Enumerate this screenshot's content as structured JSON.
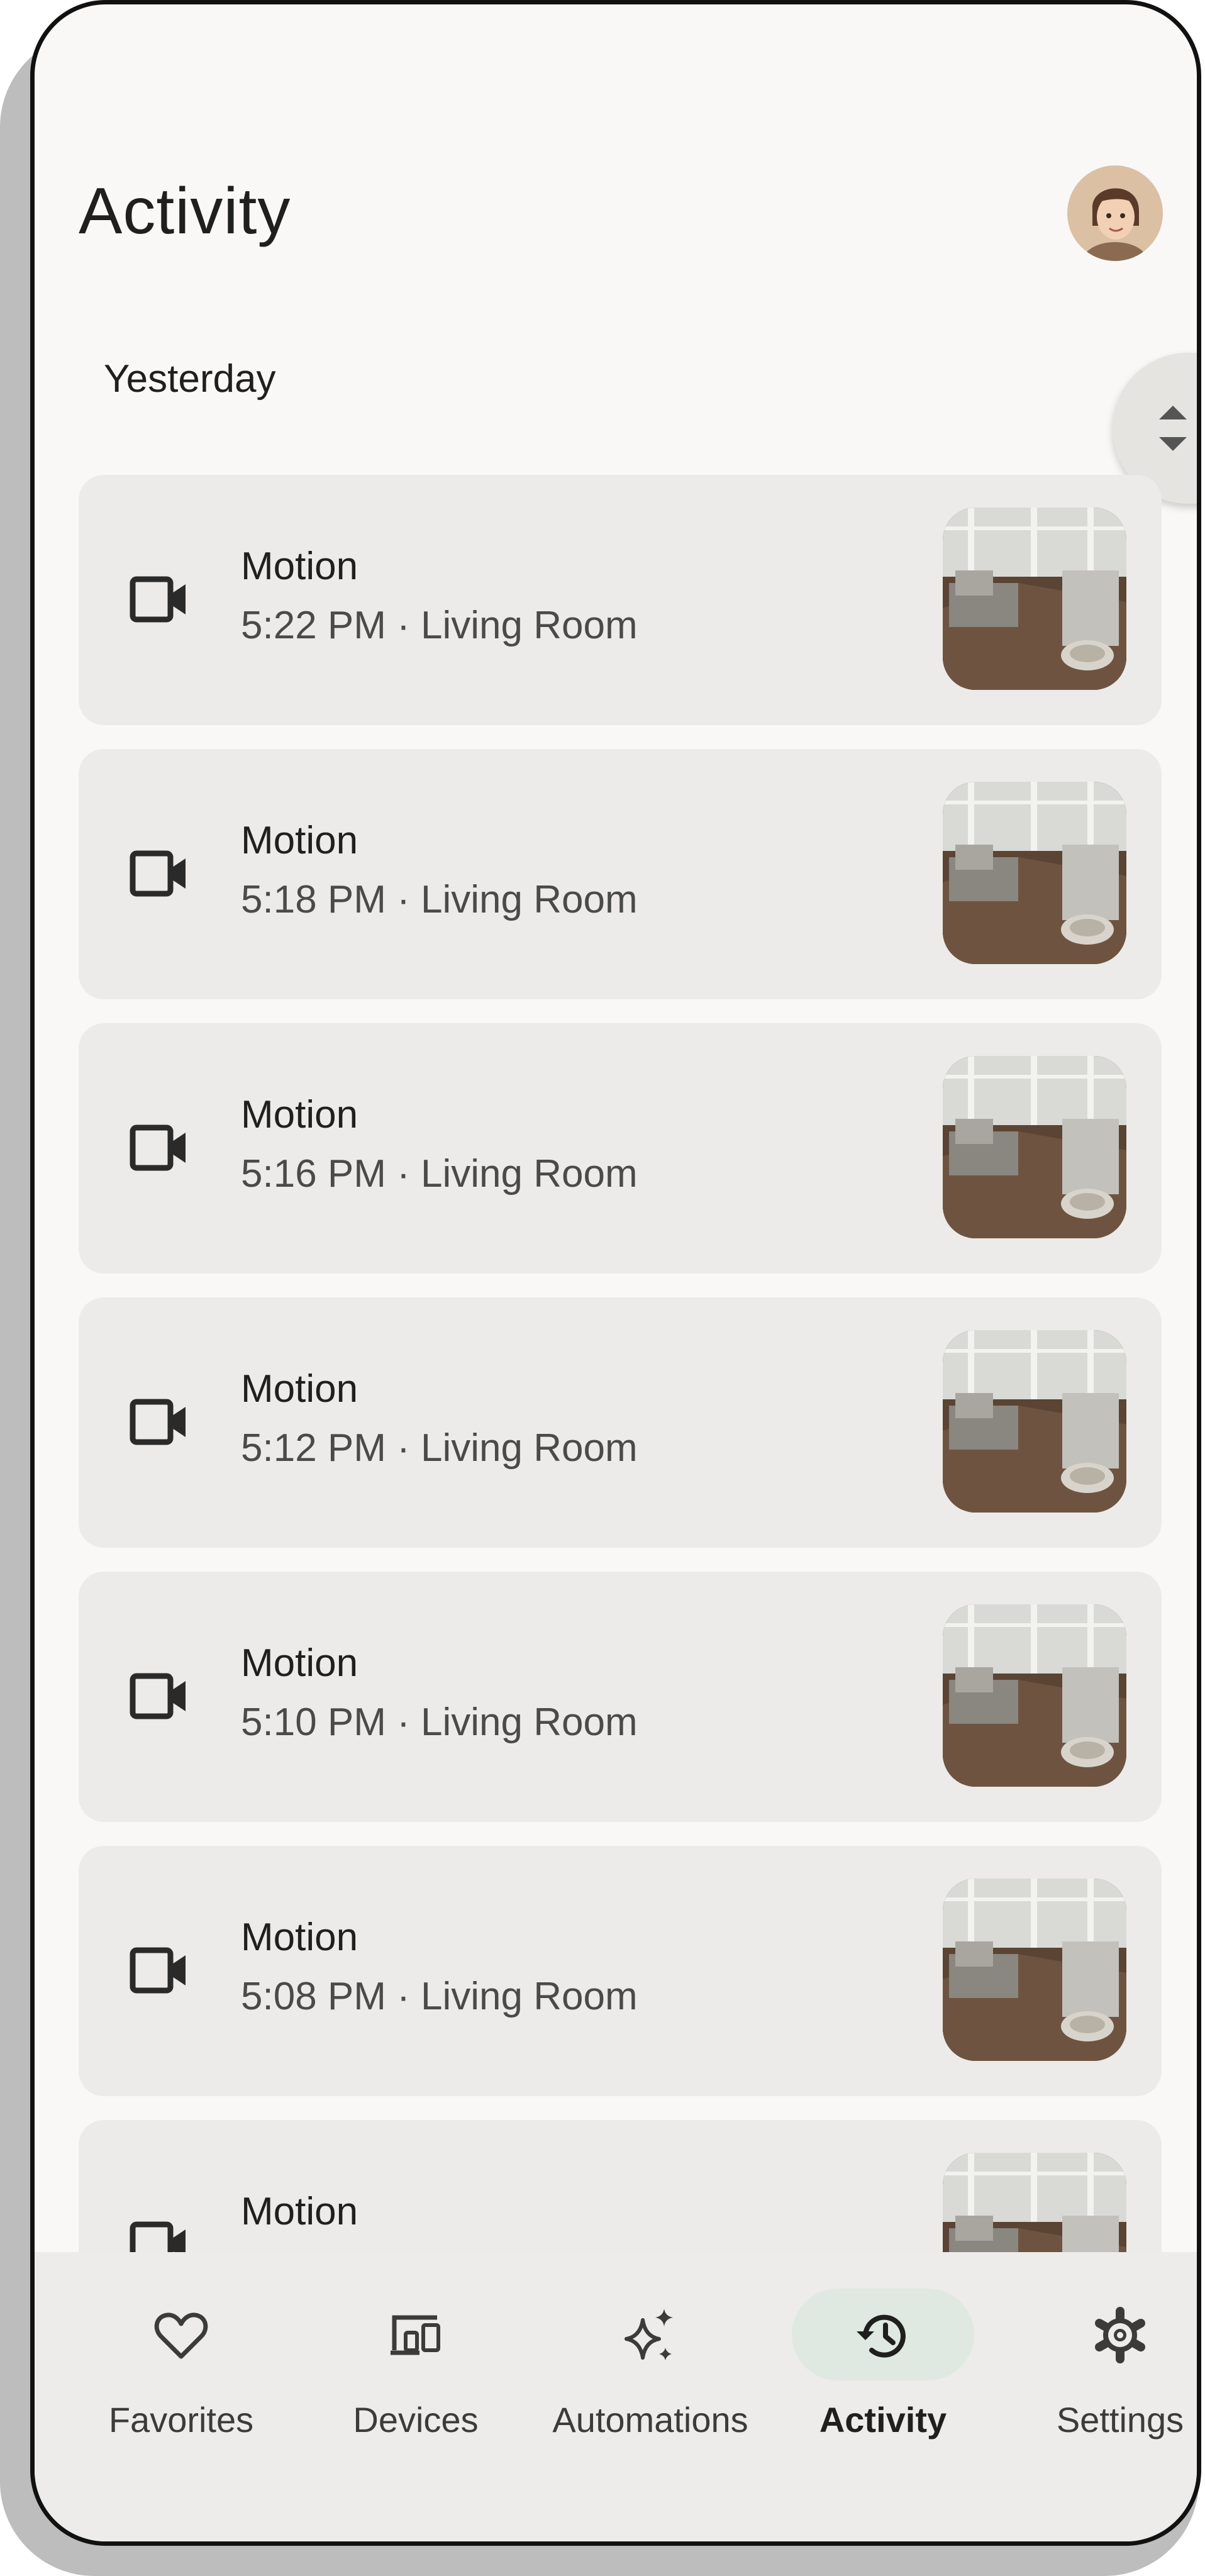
{
  "header": {
    "title": "Activity"
  },
  "section": {
    "label": "Yesterday"
  },
  "events": [
    {
      "title": "Motion",
      "subtitle": "5:22 PM · Living Room"
    },
    {
      "title": "Motion",
      "subtitle": "5:18 PM · Living Room"
    },
    {
      "title": "Motion",
      "subtitle": "5:16 PM · Living Room"
    },
    {
      "title": "Motion",
      "subtitle": "5:12 PM · Living Room"
    },
    {
      "title": "Motion",
      "subtitle": "5:10 PM · Living Room"
    },
    {
      "title": "Motion",
      "subtitle": "5:08 PM · Living Room"
    },
    {
      "title": "Motion",
      "subtitle": ""
    }
  ],
  "nav": {
    "favorites": "Favorites",
    "devices": "Devices",
    "automations": "Automations",
    "activity": "Activity",
    "settings": "Settings",
    "active": "activity"
  },
  "icons": {
    "event": "video-camera-icon",
    "favorites": "heart-icon",
    "devices": "devices-icon",
    "automations": "sparkle-icon",
    "activity": "history-icon",
    "settings": "gear-icon"
  },
  "colors": {
    "background": "#f9f8f6",
    "card": "#ecebe9",
    "active_pill": "#dfe9e1"
  }
}
